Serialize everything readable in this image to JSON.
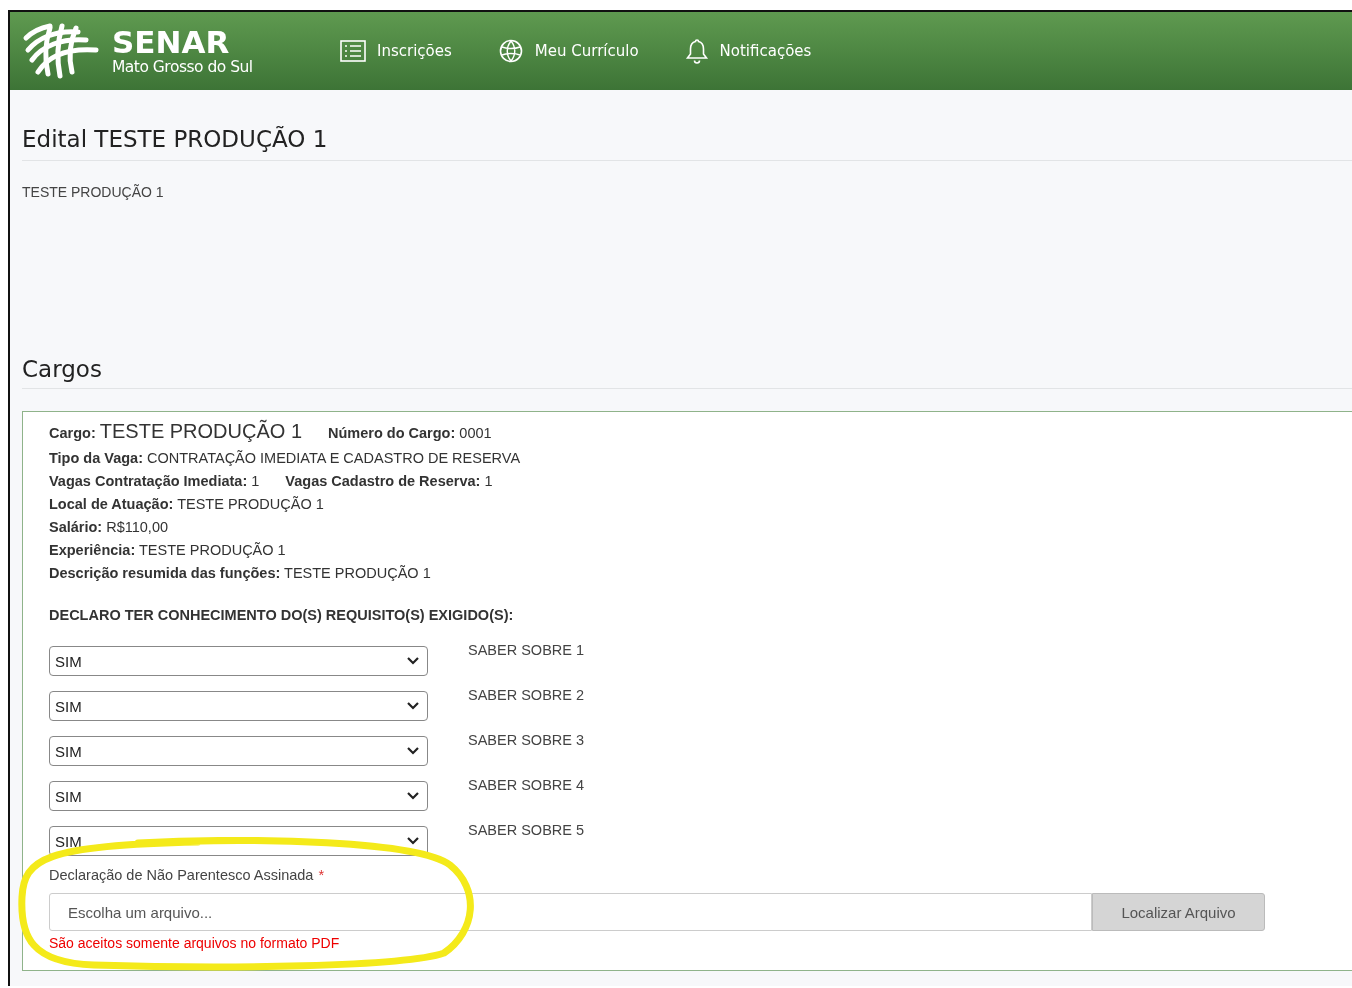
{
  "brand": {
    "name": "SENAR",
    "subtitle": "Mato Grosso do Sul"
  },
  "nav": [
    {
      "label": "Inscrições"
    },
    {
      "label": "Meu Currículo"
    },
    {
      "label": "Notificações"
    }
  ],
  "edital": {
    "title": "Edital TESTE PRODUÇÃO 1",
    "description": "TESTE PRODUÇÃO 1"
  },
  "cargos": {
    "heading": "Cargos",
    "details": [
      [
        {
          "text": "**Cargo:** ",
          "value": "TESTE PRODUÇÃO 1",
          "kind": "large"
        },
        {
          "text": "**Número do Cargo:** 0001",
          "kind": "plain"
        }
      ],
      [
        {
          "text": "**Tipo da Vaga:** CONTRATAÇÃO IMEDIATA E CADASTRO DE RESERVA",
          "kind": "plain"
        }
      ],
      [
        {
          "text": "**Vagas Contratação Imediata:** 1",
          "kind": "plain"
        },
        {
          "text": "**Vagas Cadastro de Reserva:** 1",
          "kind": "plain"
        }
      ],
      [
        {
          "text": "**Local de Atuação:** TESTE PRODUÇÃO 1",
          "kind": "plain"
        }
      ],
      [
        {
          "text": "**Salário:** R$110,00",
          "kind": "plain"
        }
      ],
      [
        {
          "text": "**Experiência:** TESTE PRODUÇÃO 1",
          "kind": "plain"
        }
      ],
      [
        {
          "text": "**Descrição resumida das funções:** TESTE PRODUÇÃO 1",
          "kind": "plain"
        }
      ]
    ],
    "requirements_heading": "DECLARO TER CONHECIMENTO DO(S) REQUISITO(S) EXIGIDO(S):",
    "requirements": [
      {
        "value": "SIM",
        "label": "SABER SOBRE 1"
      },
      {
        "value": "SIM",
        "label": "SABER SOBRE 2"
      },
      {
        "value": "SIM",
        "label": "SABER SOBRE 3"
      },
      {
        "value": "SIM",
        "label": "SABER SOBRE 4"
      },
      {
        "value": "SIM",
        "label": "SABER SOBRE 5"
      }
    ],
    "upload": {
      "label": "Declaração de Não Parentesco Assinada",
      "required_mark": "*",
      "placeholder": "Escolha um arquivo...",
      "button": "Localizar Arquivo",
      "hint": "São aceitos somente arquivos no formato PDF"
    }
  }
}
